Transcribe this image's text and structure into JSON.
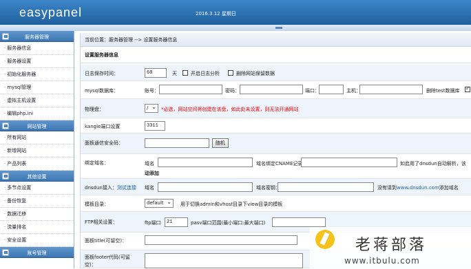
{
  "header": {
    "logo": "easypanel",
    "date": "2016.3.12 星期日"
  },
  "sidebar": {
    "groups": [
      {
        "title": "服务器管理",
        "items": [
          "服务器信息",
          "服务器设置",
          "初始化服务器",
          "mysql管理",
          "虚拟主机设置",
          "编辑php.ini"
        ]
      },
      {
        "title": "网站管理",
        "items": [
          "所有网站",
          "新增网站",
          "产品列表"
        ]
      },
      {
        "title": "其他设置",
        "items": [
          "多节点设置",
          "备份恢复",
          "数据迁移",
          "流量排名",
          "安全设置"
        ]
      },
      {
        "title": "账号管理",
        "items": []
      }
    ]
  },
  "breadcrumb": "当前位置：服务器管理 --> 设置服务器信息",
  "section_title": "设置服务器信息",
  "form": {
    "log": {
      "label": "日志保存时间：",
      "value": "60",
      "unit": "天",
      "opt1": "开启日志分析",
      "opt2": "删除网站保留数据"
    },
    "mysql": {
      "label": "mysql数据库：",
      "account": "账号：",
      "password": "密码：",
      "port": "端口：",
      "host": "主机：",
      "delete_test": "删除test数据库"
    },
    "disk": {
      "label": "物理盘：",
      "value": "/",
      "note": "*必选，网站空间将创建在该盘，如此处未设置，则无法开通网站"
    },
    "kangle": {
      "label": "kangle端口设置",
      "value": "3311"
    },
    "panel_code": {
      "label": "面板通信安全码：",
      "button": "随机"
    },
    "bind_domain": {
      "label": "绑定域名：",
      "domain": "域名",
      "cname": "域名绑定CNAME记录",
      "tail1": "如启用了dnsdun自动解析，该",
      "tail2": "动添加"
    },
    "dnsdun": {
      "label": "dnsdun接入：",
      "link": "测试连接",
      "domain": "域名",
      "key": "域名密钥：",
      "tail_pre": "没有请到",
      "tail_link": "www.dnsdun.com",
      "tail_post": "添加域名"
    },
    "template": {
      "label": "模板目录：",
      "value": "default",
      "desc": "用于切换admin和vhost目录下view目录的模板"
    },
    "ftp": {
      "label": "FTP相关设置：",
      "ftp_port": "ftp端口",
      "ftp_value": "21",
      "pasv": "pasv端口范围(最小端口:最大端口)"
    },
    "panel_title": {
      "label": "面板title(可留空)："
    },
    "panel_footer": {
      "label": "面板footer代码(可留空)："
    }
  },
  "watermark": {
    "cn": "老蒋部落",
    "url": "www.itbulu.com"
  }
}
